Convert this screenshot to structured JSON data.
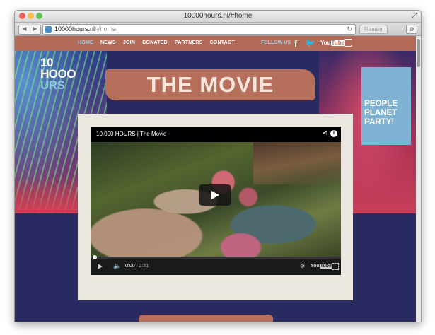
{
  "window": {
    "title": "10000hours.nl/#home"
  },
  "address_bar": {
    "url_main": "10000hours.nl",
    "url_hash": "/#home",
    "reload_icon": "reload-icon"
  },
  "toolbar": {
    "reader_label": "Reader"
  },
  "site_nav": {
    "items": [
      "HOME",
      "NEWS",
      "JOIN",
      "DONATED",
      "PARTNERS",
      "CONTACT"
    ],
    "follow_label": "FOLLOW US",
    "social_icons": [
      "facebook-icon",
      "twitter-icon",
      "youtube-icon",
      "instagram-icon"
    ]
  },
  "logo": {
    "line1": "10",
    "line2": "HOOO",
    "line3": "URS"
  },
  "banner": {
    "title": "THE MOVIE"
  },
  "tagline": {
    "line1": "PEOPLE",
    "line2": "PLANET",
    "line3": "PARTY!"
  },
  "video": {
    "title": "10.000 HOURS | The Movie",
    "current_time": "0:00",
    "duration": "/ 2:21",
    "progress": 0
  },
  "colors": {
    "nav_bar": "#b26a59",
    "nav_active": "#9fd3e8",
    "page_background": "#2a2a62",
    "banner": "#b66f5a",
    "tagline_panel": "#7fb3d3",
    "video_card": "#ebe6e0"
  }
}
